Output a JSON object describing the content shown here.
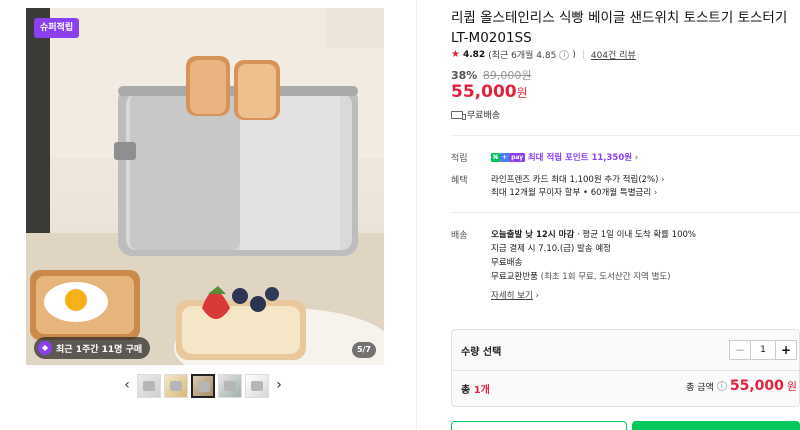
{
  "gallery": {
    "super_badge": "슈퍼적립",
    "recent_purchase": "최근 1주간 11명 구매",
    "page_counter": "5/7",
    "prev_icon": "chevron-left-icon",
    "next_icon": "chevron-right-icon",
    "thumbnail_count": 5,
    "active_thumbnail": 3
  },
  "product": {
    "title": "리큅 올스테인리스 식빵 베이글 샌드위치 토스트기 토스터기 LT-M0201SS",
    "rating": {
      "score": "4.82",
      "recent": "(최근 6개월 4.85",
      "recent_close": ")",
      "review_link": "404건 리뷰"
    },
    "discount_rate": "38%",
    "original_price": "89,000원",
    "price": "55,000",
    "price_unit": "원",
    "shipping_badge": "무료배송"
  },
  "details": {
    "points": {
      "label": "적립",
      "badge_n": "N",
      "badge_plus": "+",
      "badge_pay": "pay",
      "text": "최대 적립 포인트 11,350원"
    },
    "benefits": {
      "label": "혜택",
      "line1": "라인프렌즈 카드 최대 1,100원 추가 적립(2%)",
      "line2": "최대 12개월 무이자 할부 • 60개월 특별금리"
    },
    "delivery": {
      "label": "배송",
      "cutoff": "오늘출발 낮 12시 마감",
      "cutoff_detail": "· 평균 1일 이내 도착 확률 100%",
      "line2": "지금 결제 시 7.10.(금) 발송 예정",
      "line3": "무료배송",
      "line4_main": "무료교환반품",
      "line4_sub": "(최초 1회 무료, 도서산간 지역 별도)",
      "more_link": "자세히 보기"
    }
  },
  "order": {
    "qty_label": "수량 선택",
    "minus": "−",
    "quantity": "1",
    "plus": "+",
    "total_count_prefix": "총 ",
    "total_count_num": "1개",
    "total_label": "총 금액",
    "total_price": "55,000",
    "total_unit": "원"
  },
  "colors": {
    "accent_red": "#e4213b",
    "naver_green": "#03c75a",
    "purple": "#8a3ff0"
  }
}
